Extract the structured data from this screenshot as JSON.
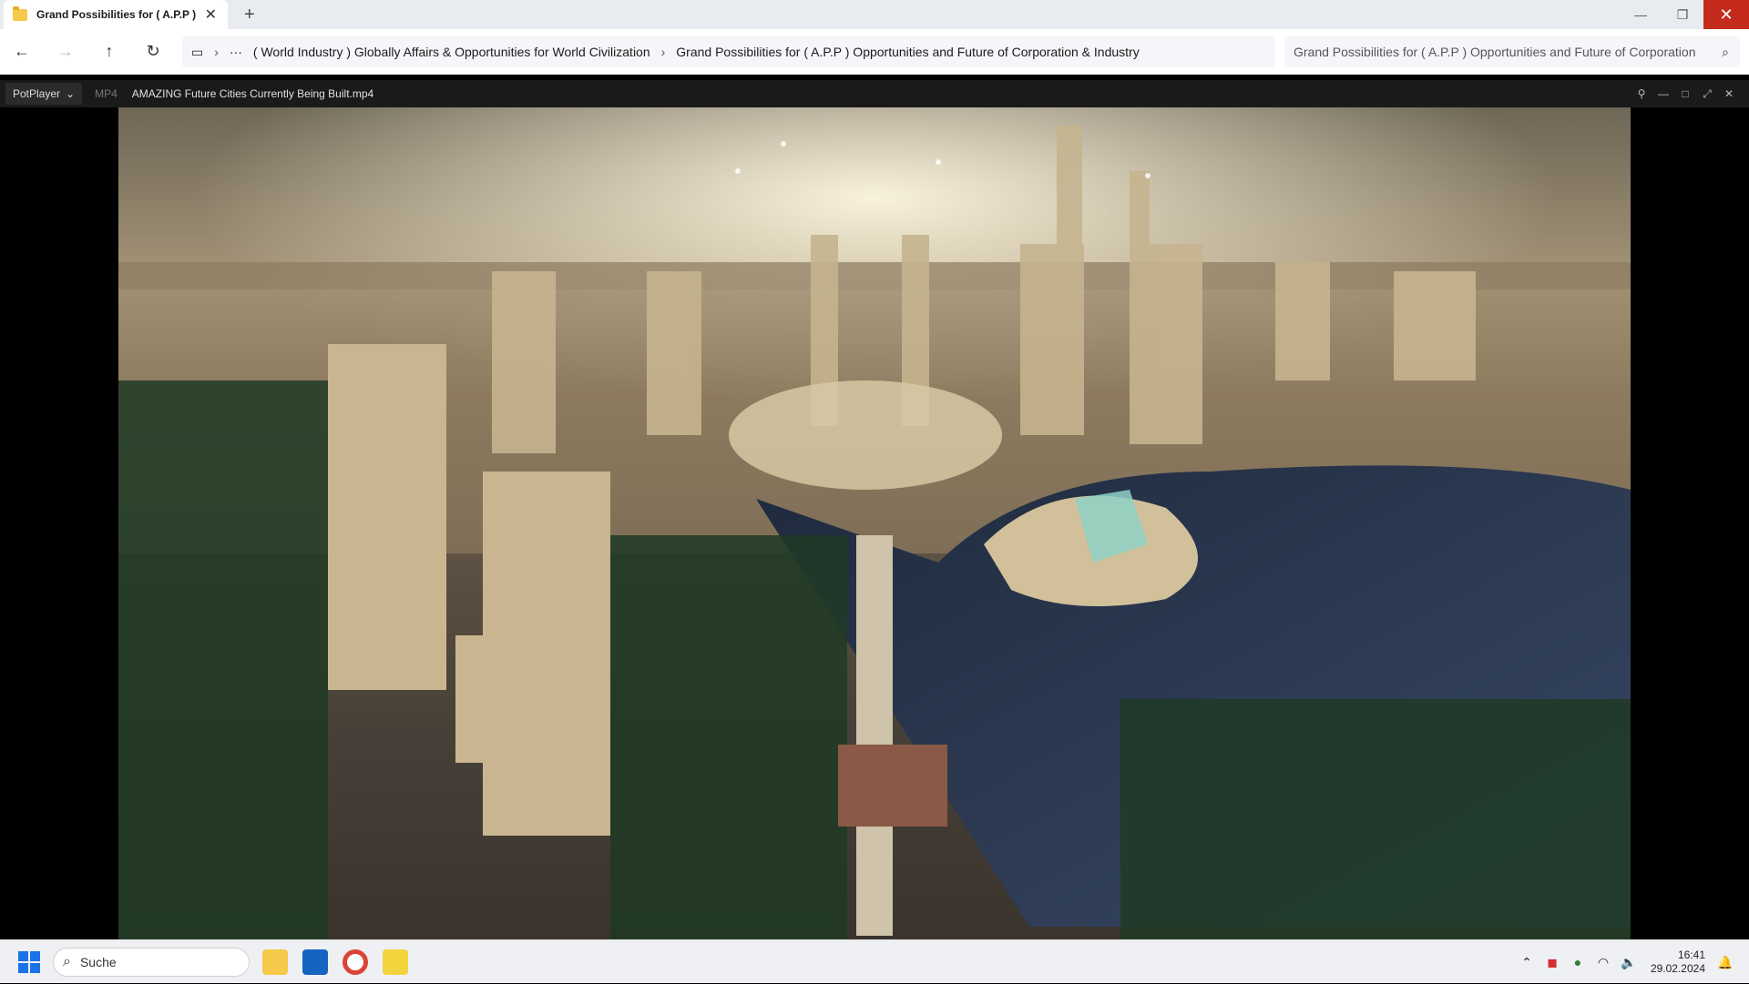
{
  "explorer": {
    "tab_title": "Grand Possibilities for ( A.P.P )",
    "breadcrumb": [
      "( World Industry ) Globally Affairs & Opportunities for World Civilization",
      "Grand Possibilities for ( A.P.P ) Opportunities and Future of Corporation & Industry"
    ],
    "search_text": "Grand Possibilities for ( A.P.P ) Opportunities and Future of Corporation"
  },
  "player": {
    "app_name": "PotPlayer",
    "format": "MP4",
    "file_title": "AMAZING Future Cities Currently Being Built.mp4"
  },
  "taskbar": {
    "search_label": "Suche",
    "time": "16:41",
    "date": "29.02.2024"
  }
}
